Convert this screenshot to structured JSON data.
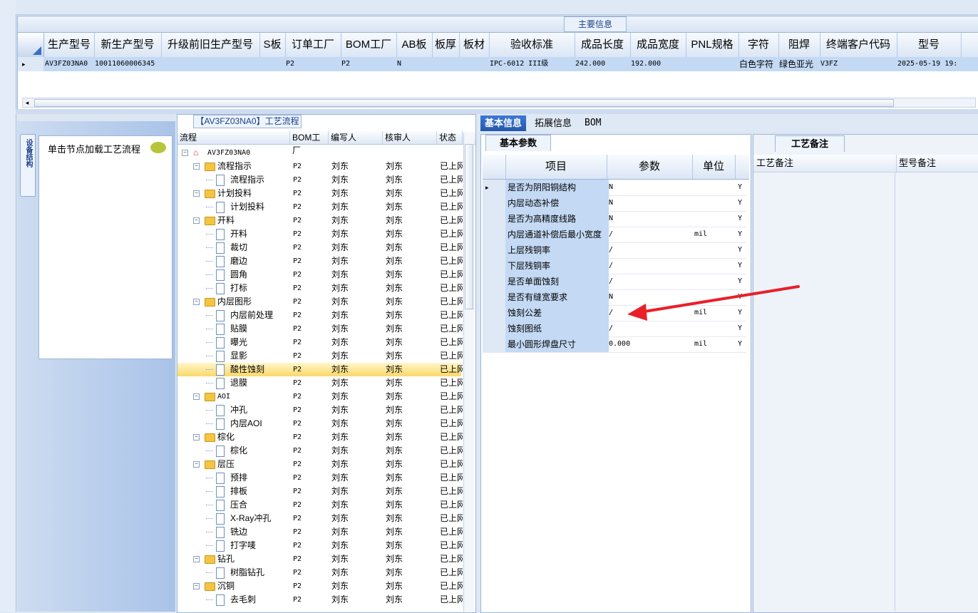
{
  "main_panel": {
    "title": "主要信息",
    "columns": [
      "生产型号",
      "新生产型号",
      "升级前旧生产型号",
      "S板",
      "订单工厂",
      "BOM工厂",
      "AB板",
      "板厚",
      "板材",
      "验收标准",
      "成品长度",
      "成品宽度",
      "PNL规格",
      "字符",
      "阻焊",
      "终端客户代码",
      "型号"
    ],
    "row": {
      "model": "AV3FZ03NA0",
      "new_model": "10011060006345",
      "old_model": "",
      "s_board": "",
      "order_factory": "P2",
      "bom_factory": "P2",
      "ab_board": "N",
      "thickness": "",
      "material": "",
      "standard": "IPC-6012 III级",
      "length": "242.000",
      "width": "192.000",
      "pnl": "",
      "char": "白色字符",
      "solder": "绿色亚光",
      "customer_code": "V3FZ",
      "date": "2025-05-19 19:"
    }
  },
  "nav": {
    "vertical_tab": "设备结构",
    "label": "单击节点加载工艺流程"
  },
  "flow": {
    "title": "【AV3FZ03NA0】工艺流程",
    "headers": [
      "流程",
      "BOM工厂",
      "编写人",
      "核审人",
      "状态"
    ],
    "root": "AV3FZ03NA0",
    "rows": [
      {
        "name": "流程指示",
        "level": 1,
        "folder": true,
        "bom": "P2",
        "writer": "刘东",
        "reviewer": "刘东",
        "status": "已上网"
      },
      {
        "name": "流程指示",
        "level": 2,
        "folder": false,
        "bom": "P2",
        "writer": "刘东",
        "reviewer": "刘东",
        "status": "已上网"
      },
      {
        "name": "计划投料",
        "level": 1,
        "folder": true,
        "bom": "P2",
        "writer": "刘东",
        "reviewer": "刘东",
        "status": "已上网"
      },
      {
        "name": "计划投料",
        "level": 2,
        "folder": false,
        "bom": "P2",
        "writer": "刘东",
        "reviewer": "刘东",
        "status": "已上网"
      },
      {
        "name": "开料",
        "level": 1,
        "folder": true,
        "bom": "P2",
        "writer": "刘东",
        "reviewer": "刘东",
        "status": "已上网"
      },
      {
        "name": "开料",
        "level": 2,
        "folder": false,
        "bom": "P2",
        "writer": "刘东",
        "reviewer": "刘东",
        "status": "已上网"
      },
      {
        "name": "裁切",
        "level": 2,
        "folder": false,
        "bom": "P2",
        "writer": "刘东",
        "reviewer": "刘东",
        "status": "已上网"
      },
      {
        "name": "磨边",
        "level": 2,
        "folder": false,
        "bom": "P2",
        "writer": "刘东",
        "reviewer": "刘东",
        "status": "已上网"
      },
      {
        "name": "圆角",
        "level": 2,
        "folder": false,
        "bom": "P2",
        "writer": "刘东",
        "reviewer": "刘东",
        "status": "已上网"
      },
      {
        "name": "打标",
        "level": 2,
        "folder": false,
        "bom": "P2",
        "writer": "刘东",
        "reviewer": "刘东",
        "status": "已上网"
      },
      {
        "name": "内层图形",
        "level": 1,
        "folder": true,
        "bom": "P2",
        "writer": "刘东",
        "reviewer": "刘东",
        "status": "已上网"
      },
      {
        "name": "内层前处理",
        "level": 2,
        "folder": false,
        "bom": "P2",
        "writer": "刘东",
        "reviewer": "刘东",
        "status": "已上网"
      },
      {
        "name": "贴膜",
        "level": 2,
        "folder": false,
        "bom": "P2",
        "writer": "刘东",
        "reviewer": "刘东",
        "status": "已上网"
      },
      {
        "name": "曝光",
        "level": 2,
        "folder": false,
        "bom": "P2",
        "writer": "刘东",
        "reviewer": "刘东",
        "status": "已上网"
      },
      {
        "name": "显影",
        "level": 2,
        "folder": false,
        "bom": "P2",
        "writer": "刘东",
        "reviewer": "刘东",
        "status": "已上网"
      },
      {
        "name": "酸性蚀刻",
        "level": 2,
        "folder": false,
        "bom": "P2",
        "writer": "刘东",
        "reviewer": "刘东",
        "status": "已上网",
        "selected": true
      },
      {
        "name": "退膜",
        "level": 2,
        "folder": false,
        "bom": "P2",
        "writer": "刘东",
        "reviewer": "刘东",
        "status": "已上网"
      },
      {
        "name": "AOI",
        "level": 1,
        "folder": true,
        "bom": "P2",
        "writer": "刘东",
        "reviewer": "刘东",
        "status": "已上网"
      },
      {
        "name": "冲孔",
        "level": 2,
        "folder": false,
        "bom": "P2",
        "writer": "刘东",
        "reviewer": "刘东",
        "status": "已上网"
      },
      {
        "name": "内层AOI",
        "level": 2,
        "folder": false,
        "bom": "P2",
        "writer": "刘东",
        "reviewer": "刘东",
        "status": "已上网"
      },
      {
        "name": "棕化",
        "level": 1,
        "folder": true,
        "bom": "P2",
        "writer": "刘东",
        "reviewer": "刘东",
        "status": "已上网"
      },
      {
        "name": "棕化",
        "level": 2,
        "folder": false,
        "bom": "P2",
        "writer": "刘东",
        "reviewer": "刘东",
        "status": "已上网"
      },
      {
        "name": "层压",
        "level": 1,
        "folder": true,
        "bom": "P2",
        "writer": "刘东",
        "reviewer": "刘东",
        "status": "已上网"
      },
      {
        "name": "预排",
        "level": 2,
        "folder": false,
        "bom": "P2",
        "writer": "刘东",
        "reviewer": "刘东",
        "status": "已上网"
      },
      {
        "name": "排板",
        "level": 2,
        "folder": false,
        "bom": "P2",
        "writer": "刘东",
        "reviewer": "刘东",
        "status": "已上网"
      },
      {
        "name": "压合",
        "level": 2,
        "folder": false,
        "bom": "P2",
        "writer": "刘东",
        "reviewer": "刘东",
        "status": "已上网"
      },
      {
        "name": "X-Ray冲孔",
        "level": 2,
        "folder": false,
        "bom": "P2",
        "writer": "刘东",
        "reviewer": "刘东",
        "status": "已上网"
      },
      {
        "name": "铣边",
        "level": 2,
        "folder": false,
        "bom": "P2",
        "writer": "刘东",
        "reviewer": "刘东",
        "status": "已上网"
      },
      {
        "name": "打字唛",
        "level": 2,
        "folder": false,
        "bom": "P2",
        "writer": "刘东",
        "reviewer": "刘东",
        "status": "已上网"
      },
      {
        "name": "钻孔",
        "level": 1,
        "folder": true,
        "bom": "P2",
        "writer": "刘东",
        "reviewer": "刘东",
        "status": "已上网"
      },
      {
        "name": "树脂钻孔",
        "level": 2,
        "folder": false,
        "bom": "P2",
        "writer": "刘东",
        "reviewer": "刘东",
        "status": "已上网"
      },
      {
        "name": "沉铜",
        "level": 1,
        "folder": true,
        "bom": "P2",
        "writer": "刘东",
        "reviewer": "刘东",
        "status": "已上网"
      },
      {
        "name": "去毛刺",
        "level": 2,
        "folder": false,
        "bom": "P2",
        "writer": "刘东",
        "reviewer": "刘东",
        "status": "已上网"
      }
    ]
  },
  "tabs": [
    "基本信息",
    "拓展信息",
    "BOM"
  ],
  "basic": {
    "subtab": "基本参数",
    "headers": [
      "项目",
      "参数",
      "单位"
    ],
    "rows": [
      {
        "item": "是否为阴阳铜结构",
        "param": "N",
        "unit": "",
        "flag": "Y"
      },
      {
        "item": "内层动态补偿",
        "param": "N",
        "unit": "",
        "flag": "Y"
      },
      {
        "item": "是否为高精度线路",
        "param": "N",
        "unit": "",
        "flag": "Y"
      },
      {
        "item": "内层通道补偿后最小宽度",
        "param": "/",
        "unit": "mil",
        "flag": "Y"
      },
      {
        "item": "上层残铜率",
        "param": "/",
        "unit": "",
        "flag": "Y"
      },
      {
        "item": "下层残铜率",
        "param": "/",
        "unit": "",
        "flag": "Y"
      },
      {
        "item": "是否单面蚀刻",
        "param": "/",
        "unit": "",
        "flag": "Y"
      },
      {
        "item": "是否有缝宽要求",
        "param": "N",
        "unit": "",
        "flag": "Y"
      },
      {
        "item": "蚀刻公差",
        "param": "/",
        "unit": "mil",
        "flag": "Y"
      },
      {
        "item": "蚀刻图纸",
        "param": "/",
        "unit": "",
        "flag": "Y"
      },
      {
        "item": "最小圆形焊盘尺寸",
        "param": "0.000",
        "unit": "mil",
        "flag": "Y"
      }
    ]
  },
  "notes": {
    "tab": "工艺备注",
    "col1": "工艺备注",
    "col2": "型号备注"
  }
}
